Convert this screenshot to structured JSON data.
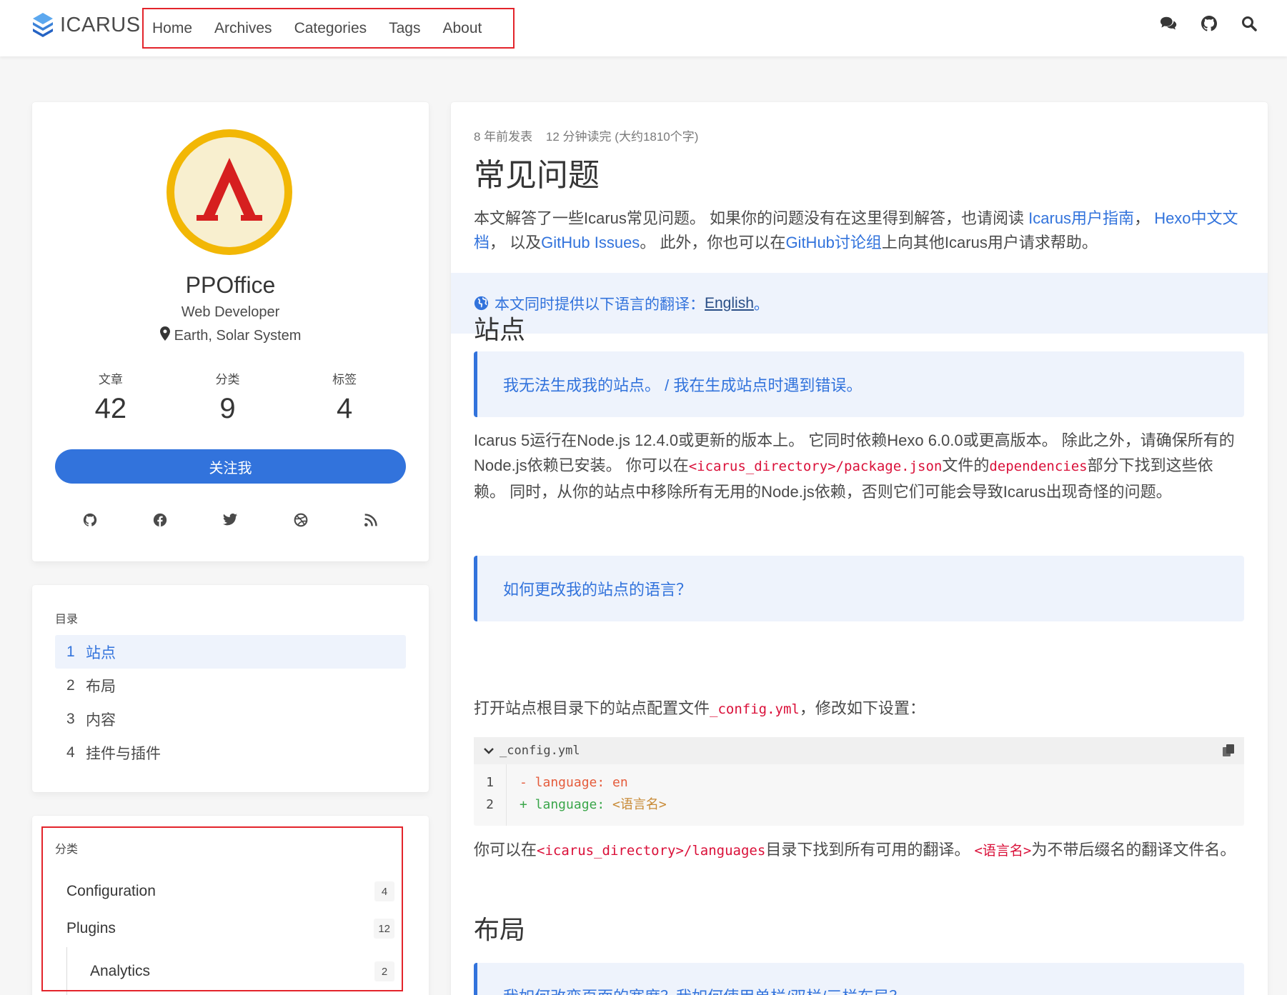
{
  "nav": {
    "logo_text": "ICARUS",
    "items": [
      "Home",
      "Archives",
      "Categories",
      "Tags",
      "About"
    ],
    "icons": [
      "comments-icon",
      "github-icon",
      "search-icon"
    ]
  },
  "profile": {
    "name": "PPOffice",
    "title": "Web Developer",
    "location": "Earth, Solar System",
    "stats": [
      {
        "label": "文章",
        "value": "42"
      },
      {
        "label": "分类",
        "value": "9"
      },
      {
        "label": "标签",
        "value": "4"
      }
    ],
    "follow_label": "关注我",
    "socials": [
      "github-icon",
      "facebook-icon",
      "twitter-icon",
      "dribbble-icon",
      "rss-icon"
    ]
  },
  "toc": {
    "title": "目录",
    "items": [
      {
        "num": "1",
        "label": "站点"
      },
      {
        "num": "2",
        "label": "布局"
      },
      {
        "num": "3",
        "label": "内容"
      },
      {
        "num": "4",
        "label": "挂件与插件"
      }
    ]
  },
  "categories": {
    "title": "分类",
    "items": [
      {
        "label": "Configuration",
        "count": "4"
      },
      {
        "label": "Plugins",
        "count": "12"
      },
      {
        "label": "Analytics",
        "count": "2"
      }
    ]
  },
  "article": {
    "meta_posted": "8 年前发表",
    "meta_read": "12 分钟读完 (大约1810个字)",
    "title": "常见问题",
    "intro_1": "本文解答了一些Icarus常见问题。 如果你的问题没有在这里得到解答，也请阅读 ",
    "link_guide": "Icarus用户指南",
    "intro_2": "， ",
    "link_hexo": "Hexo中文文档",
    "intro_3": "， 以及",
    "link_issues": "GitHub Issues",
    "intro_4": "。 此外，你也可以在",
    "link_discuss": "GitHub讨论组",
    "intro_5": "上向其他Icarus用户请求帮助。",
    "lang_note": "本文同时提供以下语言的翻译：",
    "lang_link": "English",
    "lang_end": "。",
    "h_site": "站点",
    "q1": "我无法生成我的站点。 / 我在生成站点时遇到错误。",
    "p1_a": "Icarus 5运行在Node.js 12.4.0或更新的版本上。 它同时依赖Hexo 6.0.0或更高版本。 除此之外，请确保所有的Node.js依赖已安装。 你可以在",
    "p1_code1": "<icarus_directory>/package.json",
    "p1_b": "文件的",
    "p1_code2": "dependencies",
    "p1_c": "部分下找到这些依赖。 同时，从你的站点中移除所有无用的Node.js依赖，否则它们可能会导致Icarus出现奇怪的问题。",
    "q2": "如何更改我的站点的语言？",
    "p2_a": "打开站点根目录下的站点配置文件",
    "p2_code": "_config.yml",
    "p2_b": "，修改如下设置：",
    "code_file": "_config.yml",
    "code_nums": [
      "1",
      "2"
    ],
    "code_del": "- language: en",
    "code_add_key": "+ language: ",
    "code_add_val": "<语言名>",
    "p3_a": "你可以在",
    "p3_code": "<icarus_directory>/languages",
    "p3_b": "目录下找到所有可用的翻译。 ",
    "p3_code2": "<语言名>",
    "p3_c": "为不带后缀名的翻译文件名。",
    "h_layout": "布局",
    "q3": "我如何改变页面的宽度？我如何使用单栏/双栏/三栏布局？"
  },
  "colors": {
    "accent": "#3273dc",
    "highlight_box": "#e3242b",
    "code_red": "#da1039"
  }
}
